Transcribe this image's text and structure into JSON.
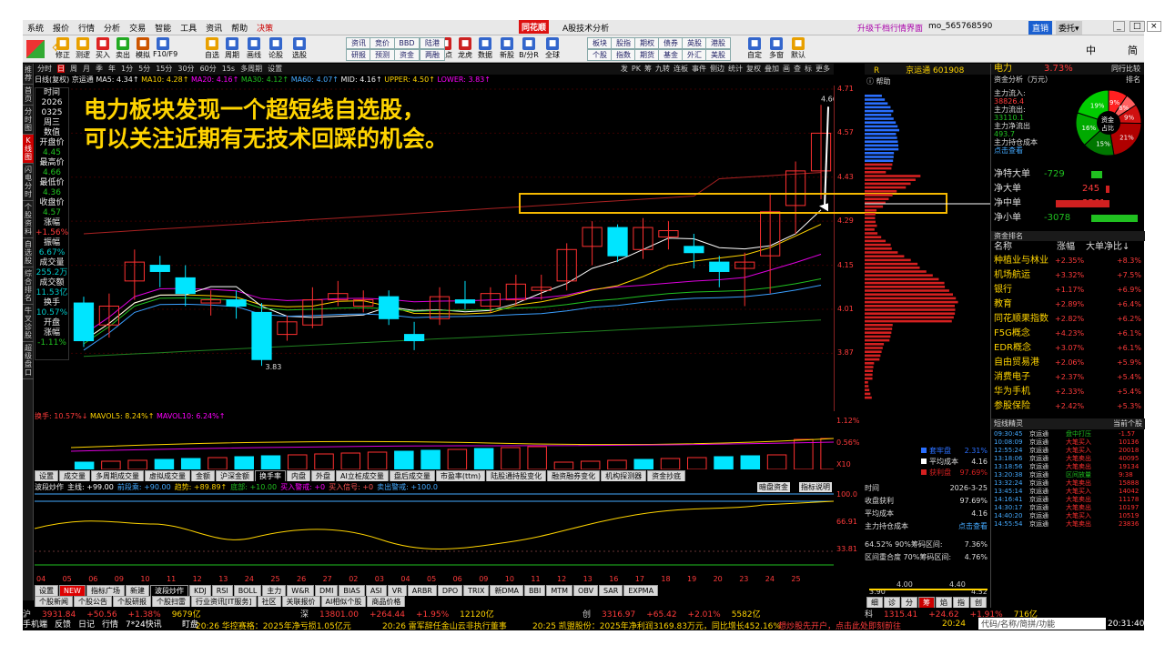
{
  "title_bar": {
    "logo": "同花顺",
    "app": "A股技术分析",
    "upgrade": "升级千档行情界面",
    "user": "mo_565768590",
    "btn_direct": "直销",
    "btn_dropdown": "委托▾"
  },
  "menu": [
    "系统",
    "报价",
    "行情",
    "分析",
    "交易",
    "智能",
    "工具",
    "资讯",
    "帮助",
    "决策"
  ],
  "toolbar_icons": [
    {
      "label": "修正",
      "icon": "undo-icon"
    },
    {
      "label": "测逻",
      "icon": "test-icon"
    },
    {
      "label": "买入",
      "icon": "buy-icon"
    },
    {
      "label": "卖出",
      "icon": "sell-icon"
    },
    {
      "label": "模拟",
      "icon": "simulate-icon"
    },
    {
      "label": "F10/F9",
      "icon": "f10-icon"
    },
    {
      "label": "自选",
      "icon": "watchlist-icon"
    },
    {
      "label": "周期",
      "icon": "period-icon"
    },
    {
      "label": "画线",
      "icon": "draw-icon"
    },
    {
      "label": "论股",
      "icon": "forum-icon"
    },
    {
      "label": "选股",
      "icon": "select-icon"
    },
    {
      "label": "热点",
      "icon": "hot-icon"
    },
    {
      "label": "龙虎",
      "icon": "dragon-icon"
    },
    {
      "label": "数据",
      "icon": "data-icon"
    },
    {
      "label": "新股",
      "icon": "ipo-icon"
    },
    {
      "label": "B/分R",
      "icon": "bfr-icon"
    },
    {
      "label": "全球",
      "icon": "globe-icon"
    },
    {
      "label": "自定",
      "icon": "custom-icon"
    },
    {
      "label": "多窗",
      "icon": "window-icon"
    },
    {
      "label": "默认",
      "icon": "home-icon"
    }
  ],
  "toolbar_btns_top": [
    "资讯",
    "竞价",
    "BBD",
    "陆港",
    "板块",
    "股指",
    "期权",
    "债券",
    "英股",
    "港股"
  ],
  "toolbar_btns_bot": [
    "研报",
    "预测",
    "资金",
    "两融",
    "个股",
    "指数",
    "期货",
    "基金",
    "外汇",
    "美股"
  ],
  "right_tools": [
    "中",
    "简"
  ],
  "chart_header": {
    "periods": [
      "分时",
      "日",
      "周",
      "月",
      "季",
      "年",
      "1分",
      "5分",
      "15分",
      "30分",
      "60分",
      "15s",
      "多周期",
      "设置"
    ],
    "right_items": [
      "发",
      "PK",
      "筹",
      "九转",
      "连板",
      "事件",
      "侧边",
      "统计",
      "复权",
      "叠加",
      "画",
      "查",
      "标",
      "更多"
    ]
  },
  "ma_line": {
    "label": "日线(复权)",
    "stock": "京运通",
    "items": [
      "MA5: 4.34↑",
      "MA10: 4.28↑",
      "MA20: 4.16↑",
      "MA30: 4.12↑",
      "MA60: 4.07↑",
      "MID: 4.16↑",
      "UPPER: 4.50↑",
      "LOWER: 3.83↑"
    ]
  },
  "left_panel": [
    {
      "label": "时间",
      "value": ""
    },
    {
      "label": "2026",
      "value": ""
    },
    {
      "label": "0325",
      "value": ""
    },
    {
      "label": "周三",
      "value": ""
    },
    {
      "label": "数值",
      "value": ""
    },
    {
      "label": "开盘价",
      "value": "4.45"
    },
    {
      "label": "最高价",
      "value": "4.66"
    },
    {
      "label": "最低价",
      "value": "4.36"
    },
    {
      "label": "收盘价",
      "value": "4.57"
    },
    {
      "label": "涨幅",
      "value": "+1.56%"
    },
    {
      "label": "振幅",
      "value": "6.67%"
    },
    {
      "label": "成交量",
      "value": "255.2万"
    },
    {
      "label": "成交额",
      "value": "11.53亿"
    },
    {
      "label": "换手",
      "value": "10.57%"
    },
    {
      "label": "开盘",
      "value": ""
    },
    {
      "label": "涨幅",
      "value": "-1.11%"
    }
  ],
  "vtabs": [
    "推荐",
    "首页",
    "分时图",
    "K线图",
    "闪电分时",
    "个股资料",
    "自选股",
    "综合排名",
    "牛叉诊股",
    "超级盘口"
  ],
  "annotation": {
    "line1": "电力板块发现一个超短线自选股，",
    "line2": "可以关注近期有无技术回踩的机会。"
  },
  "price_axis": [
    "4.71",
    "4.57",
    "4.43",
    "4.29",
    "4.15",
    "4.01",
    "3.87"
  ],
  "chart_labels": {
    "high": "4.66",
    "low": "3.83"
  },
  "volume_header": {
    "turnover": "换手: 10.57%↓",
    "mavol5": "MAVOL5: 8.24%↑",
    "mavol10": "MAVOL10: 6.24%↑"
  },
  "volume_axis": [
    "1.12%",
    "0.56%",
    "X10"
  ],
  "indicator_tabs": [
    "设置",
    "成交量",
    "多周期成交量",
    "虚拟成交量",
    "金额",
    "沪深金额",
    "换手率",
    "内盘",
    "外盘",
    "AI立桩成交量",
    "盘后成交量",
    "市盈率(ttm)",
    "陆股通持股变化",
    "融资融券变化",
    "机构探测器",
    "资金抄底"
  ],
  "bottom_indicator": {
    "label": "波段炒作",
    "vals": [
      "主线: +99.00",
      "前段乘: +90.00",
      "趋势: +89.89↑",
      "底部: +10.00",
      "买入警戒: +0",
      "买入信号: +0",
      "卖出警戒: +100.0"
    ],
    "btn1": "暗盘资金",
    "btn2": "指标说明",
    "axis": [
      "100.0",
      "66.91",
      "33.81"
    ]
  },
  "date_axis": [
    "04",
    "05",
    "06",
    "09",
    "10",
    "11",
    "12",
    "13",
    "24",
    "25",
    "26",
    "27",
    "02",
    "03",
    "04",
    "05",
    "06",
    "09",
    "10",
    "11",
    "12",
    "13",
    "16",
    "17",
    "18",
    "19",
    "20",
    "23",
    "24",
    "25"
  ],
  "bottom_tabs": [
    "设置",
    "NEW",
    "指标广场",
    "新建",
    "波段炒作",
    "KDJ",
    "RSI",
    "BOLL",
    "主力",
    "W&R",
    "DMI",
    "BIAS",
    "ASI",
    "VR",
    "ARBR",
    "DPO",
    "TRIX",
    "新DMA",
    "BBI",
    "MTM",
    "OBV",
    "SAR",
    "EXPMA"
  ],
  "info_tabs": [
    "个股新闻",
    "个股公告",
    "个股研报",
    "个股扫雷",
    "行业资讯[IT服务]",
    "社区",
    "关联报价",
    "AI相似个股",
    "商品价格"
  ],
  "right_panel": {
    "stock_code": "R",
    "stock_name": "京运通",
    "code": "601908",
    "sector": "电力",
    "sector_pct": "3.73%",
    "industry_btn": "同行比较",
    "cost_label": "资金分析（万元）",
    "rank_btn": "排名",
    "help": "帮助",
    "flows": [
      {
        "label": "主力流入:",
        "value": "38826.4"
      },
      {
        "label": "主力流出:",
        "value": "33110.1"
      },
      {
        "label": "主力净流出",
        "value": "493.7"
      },
      {
        "label": "主力持仓成本",
        "value": "点击查看"
      }
    ],
    "pie": {
      "center": "资金占比",
      "segs": [
        "9%",
        "6%",
        "9%",
        "21%",
        "15%",
        "16%",
        "19%"
      ]
    },
    "orders": [
      {
        "label": "净特大单",
        "value": "-729"
      },
      {
        "label": "净大单",
        "value": "245"
      },
      {
        "label": "净中单",
        "value": "3561"
      },
      {
        "label": "净小单",
        "value": "-3078"
      }
    ],
    "sector_title": "资金排名",
    "sector_header": [
      "名称",
      "涨幅",
      "大单净比↓"
    ],
    "sectors": [
      {
        "name": "种植业与林业",
        "pct": "+2.35%",
        "net": "+8.3%"
      },
      {
        "name": "机场航运",
        "pct": "+3.32%",
        "net": "+7.5%"
      },
      {
        "name": "银行",
        "pct": "+1.17%",
        "net": "+6.9%"
      },
      {
        "name": "教育",
        "pct": "+2.89%",
        "net": "+6.4%"
      },
      {
        "name": "同花顺果指数",
        "pct": "+2.82%",
        "net": "+6.2%"
      },
      {
        "name": "F5G概念",
        "pct": "+4.23%",
        "net": "+6.1%"
      },
      {
        "name": "EDR概念",
        "pct": "+3.07%",
        "net": "+6.1%"
      },
      {
        "name": "自由贸易港",
        "pct": "+2.06%",
        "net": "+5.9%"
      },
      {
        "name": "消费电子",
        "pct": "+2.37%",
        "net": "+5.4%"
      },
      {
        "name": "华为手机",
        "pct": "+2.33%",
        "net": "+5.4%"
      },
      {
        "name": "参股保险",
        "pct": "+2.42%",
        "net": "+5.3%"
      }
    ],
    "trade_title": "短线精灵",
    "trade_btn": "当前个股",
    "trades": [
      [
        "09:30:45",
        "京运通",
        "盘中打压",
        "-1.57"
      ],
      [
        "10:08:09",
        "京运通",
        "大笔买入",
        "10136"
      ],
      [
        "12:55:24",
        "京运通",
        "大笔买入",
        "20018"
      ],
      [
        "13:18:06",
        "京运通",
        "大笔卖出",
        "40095"
      ],
      [
        "13:18:56",
        "京运通",
        "大笔卖出",
        "19134"
      ],
      [
        "13:20:38",
        "京运通",
        "区间放量",
        "9:38"
      ],
      [
        "13:32:24",
        "京运通",
        "大笔卖出",
        "15888"
      ],
      [
        "13:45:14",
        "京运通",
        "大笔买入",
        "14042"
      ],
      [
        "14:16:41",
        "京运通",
        "大笔卖出",
        "11178"
      ],
      [
        "14:30:17",
        "京运通",
        "大笔卖出",
        "10197"
      ],
      [
        "14:40:20",
        "京运通",
        "大笔买入",
        "10519"
      ],
      [
        "14:55:54",
        "京运通",
        "大笔卖出",
        "23836"
      ]
    ]
  },
  "chip_panel": {
    "legend": [
      {
        "label": "套牢盘",
        "value": "2.31%"
      },
      {
        "label": "平均成本",
        "value": "4.16"
      },
      {
        "label": "获利盘",
        "value": "97.69%"
      }
    ],
    "time_label": "时间",
    "time": "2026-3-25",
    "profit_label": "收盘获利",
    "profit": "97.69%",
    "avg_label": "平均成本",
    "avg": "4.16",
    "cost_label": "主力持仓成本",
    "cost": "点击查看",
    "r90": "64.52%",
    "r90_label": "90%筹码区间:",
    "r90_val": "7.36%",
    "r70_label": "区间重合度",
    "r70_text": "70%筹码区间:",
    "r70_val": "4.76%",
    "axis_lo": "3.90",
    "axis_mid": "4.00",
    "axis_hi": "4.40",
    "axis_top": "4.52"
  },
  "chip_tabs": [
    "细",
    "诊",
    "分",
    "筹",
    "焰",
    "指",
    "创"
  ],
  "status": [
    {
      "name": "沪",
      "val": "3931.84",
      "chg": "+50.56",
      "pct": "+1.38%",
      "amt": "9679亿"
    },
    {
      "name": "深",
      "val": "13801.00",
      "chg": "+264.44",
      "pct": "+1.95%",
      "amt": "12120亿"
    },
    {
      "name": "创",
      "val": "3316.97",
      "chg": "+65.42",
      "pct": "+2.01%",
      "amt": "5582亿"
    },
    {
      "name": "科",
      "val": "1315.41",
      "chg": "+24.62",
      "pct": "+1.91%",
      "amt": "716亿"
    }
  ],
  "ticker": {
    "left_tabs": [
      "手机端",
      "反馈",
      "日记",
      "行情",
      "7*24快讯",
      "盯盘"
    ],
    "news": [
      "20:26 华控赛格：2025年净亏损1.05亿元",
      "20:26 雷军辞任金山云非执行董事",
      "20:25 凯盟股份：2025年净利润3169.83万元，同比增长452.16%",
      "想炒股先开户，点击此处即刻前往",
      "20:24"
    ],
    "search": "代码/名称/简拼/功能",
    "time": "20:31:40"
  }
}
